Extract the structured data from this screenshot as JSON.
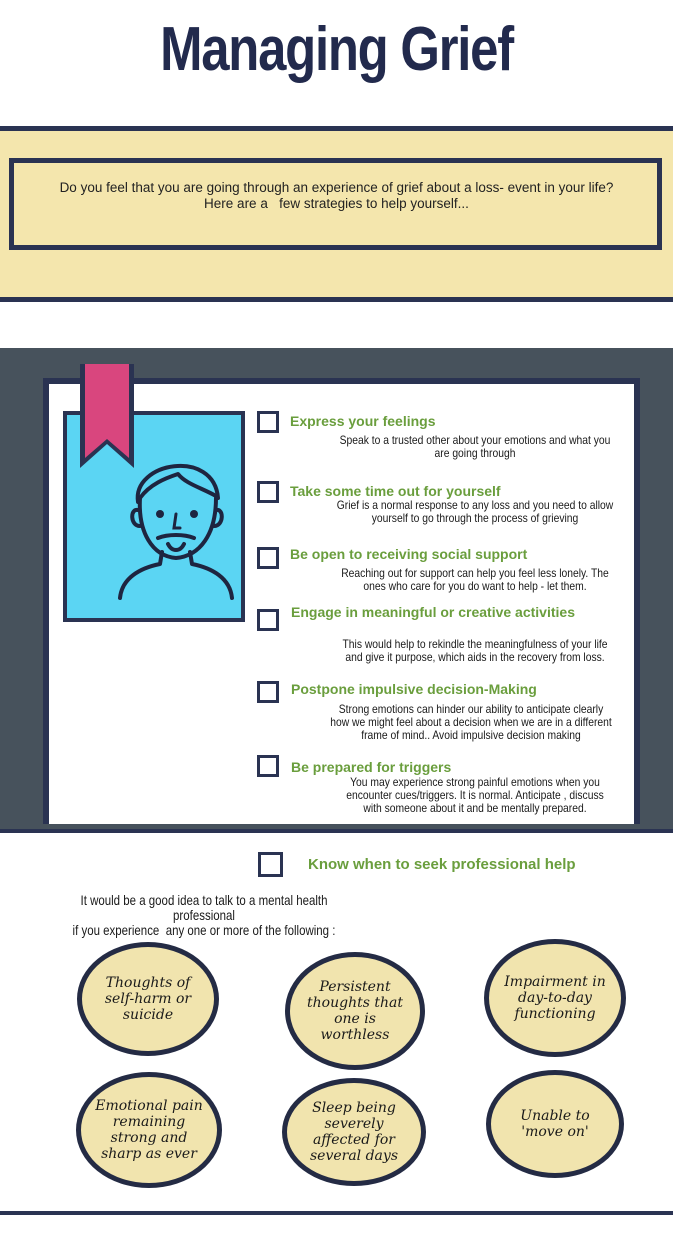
{
  "header": {
    "title": "Managing Grief"
  },
  "intro": {
    "line1": "Do you feel that you are going through an experience of grief about a loss- event in your life?",
    "line2": "Here are a   few strategies to help yourself..."
  },
  "strategies": [
    {
      "title": "Express your feelings",
      "desc_lines": [
        "Speak to a trusted other about your emotions and what you",
        "are going through"
      ]
    },
    {
      "title": "Take some time out for yourself",
      "desc_lines": [
        "Grief is a normal response to any loss and you need to allow",
        "yourself to go through the process of grieving"
      ]
    },
    {
      "title": "Be open to receiving social support",
      "desc_lines": [
        "Reaching out for support can help you feel less lonely. The",
        "ones who care for you do want to help - let them."
      ]
    },
    {
      "title": "Engage in meaningful or creative activities",
      "desc_lines": [
        "This would help to rekindle the meaningfulness of your life",
        "and give it purpose, which aids in the recovery from loss."
      ]
    },
    {
      "title": "Postpone impulsive decision-Making",
      "desc_lines": [
        "Strong emotions can  hinder our ability to anticipate clearly",
        "how we might feel about a decision when we are in a different",
        "frame of mind.. Avoid impulsive decision making"
      ]
    },
    {
      "title": "Be prepared for triggers",
      "desc_lines": [
        "You may experience strong painful emotions when you",
        "encounter cues/triggers. It is normal. Anticipate , discuss",
        "with someone about it and be mentally prepared."
      ]
    }
  ],
  "professional": {
    "title": "Know when to seek professional help",
    "intro_line1": "It would be a good idea to talk to a mental health professional",
    "intro_line2": "if you experience  any one or more of the following :",
    "signs": [
      "Thoughts of self-harm or suicide",
      "Persistent thoughts that one is  worthless",
      "Impairment in day-to-day functioning",
      "Emotional pain remaining strong and sharp as ever",
      "Sleep being severely affected for several days",
      "Unable to 'move on'"
    ]
  },
  "colors": {
    "navy": "#2a3352",
    "cream": "#f4e6ad",
    "green": "#6a9e3d",
    "slate": "#47525c",
    "sky": "#5bd5f3",
    "pink": "#d9467e"
  }
}
